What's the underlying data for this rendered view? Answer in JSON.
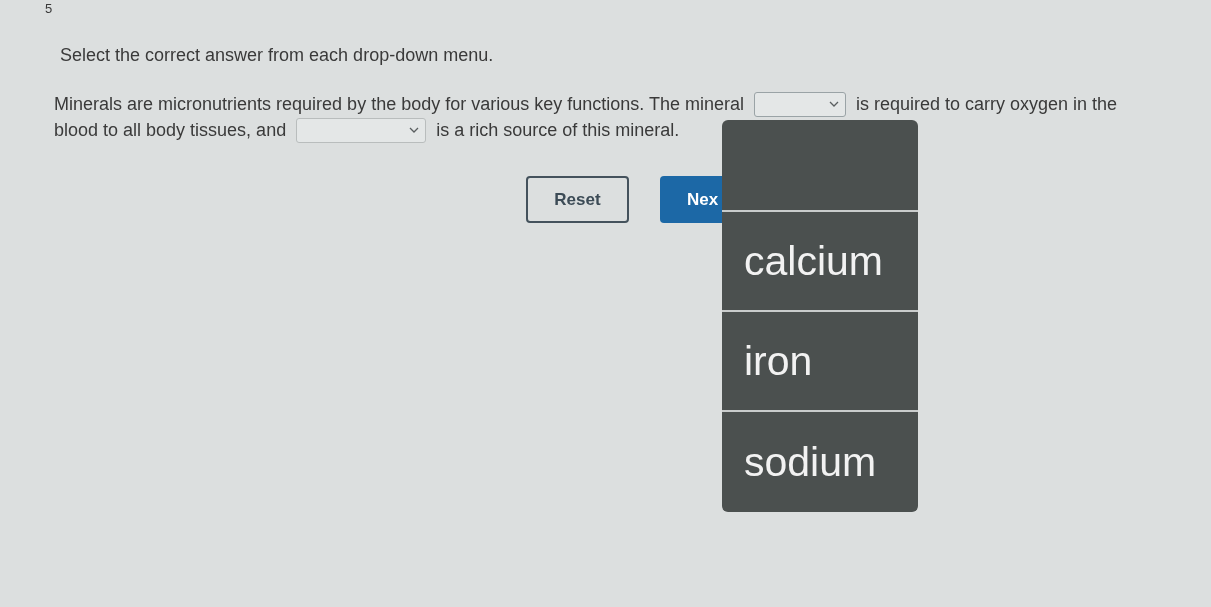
{
  "question_number": "5",
  "instruction": "Select the correct answer from each drop-down menu.",
  "passage": {
    "lines": [
      [
        {
          "kind": "text",
          "text": "Minerals are micronutrients required by the body for various key functions. The mineral"
        },
        {
          "kind": "dropdown",
          "expanded": true,
          "options": [
            {
              "label": "calcium",
              "selected": false
            },
            {
              "label": "iron",
              "selected": false
            },
            {
              "label": "sodium",
              "selected": false
            }
          ]
        },
        {
          "kind": "text",
          "text": "is required to carry oxygen in the"
        }
      ],
      [
        {
          "kind": "text",
          "text": "blood to all body tissues, and"
        },
        {
          "kind": "dropdown"
        },
        {
          "kind": "text",
          "text": "is a rich source of this mineral."
        }
      ]
    ]
  },
  "buttons": [
    {
      "label": "Reset",
      "kind": "outline"
    },
    {
      "label": "Nex",
      "kind": "primary"
    }
  ]
}
